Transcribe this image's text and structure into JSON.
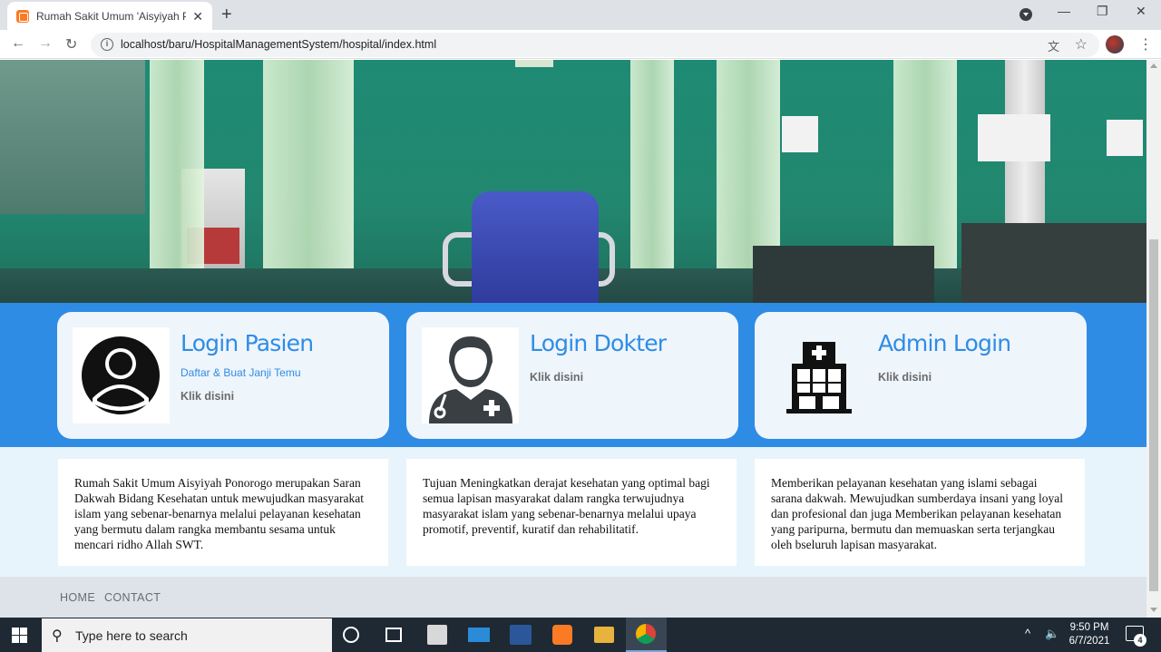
{
  "browser": {
    "tab_title": "Rumah Sakit Umum 'Aisyiyah Ponorogo",
    "new_tab": "+",
    "url": "localhost/baru/HospitalManagementSystem/hospital/index.html",
    "window_controls": {
      "minimize": "—",
      "restore": "❐",
      "close": "✕"
    }
  },
  "login_cards": [
    {
      "title": "Login Pasien",
      "subtitle": "Daftar & Buat Janji Temu",
      "link": "Klik disini",
      "icon": "patient-avatar-icon"
    },
    {
      "title": "Login Dokter",
      "subtitle": "",
      "link": "Klik disini",
      "icon": "doctor-icon"
    },
    {
      "title": "Admin Login",
      "subtitle": "",
      "link": "Klik disini",
      "icon": "hospital-building-icon"
    }
  ],
  "info_boxes": [
    {
      "text": "Rumah Sakit Umum Aisyiyah Ponorogo merupakan Saran Dakwah Bidang Kesehatan untuk mewujudkan masyarakat islam yang sebenar-benarnya melalui pelayanan kesehatan yang bermutu dalam rangka membantu sesama untuk mencari ridho Allah SWT."
    },
    {
      "text": "Tujuan Meningkatkan derajat kesehatan yang optimal bagi semua lapisan masyarakat dalam rangka terwujudnya masyarakat islam yang sebenar-benarnya melalui upaya promotif, preventif, kuratif dan rehabilitatif."
    },
    {
      "text": "Memberikan pelayanan kesehatan yang islami sebagai sarana dakwah. Mewujudkan sumberdaya insani yang loyal dan profesional dan juga Memberikan pelayanan kesehatan yang paripurna, bermutu dan memuaskan serta terjangkau oleh bseluruh lapisan masyarakat."
    }
  ],
  "footer": {
    "links": [
      "HOME",
      "CONTACT"
    ]
  },
  "taskbar": {
    "search_placeholder": "Type here to search",
    "time": "9:50 PM",
    "date": "6/7/2021",
    "notifications": "4"
  },
  "colors": {
    "brand_blue": "#2f8ce5",
    "card_bg": "#eef5fb",
    "page_bg": "#e8f4fc"
  }
}
